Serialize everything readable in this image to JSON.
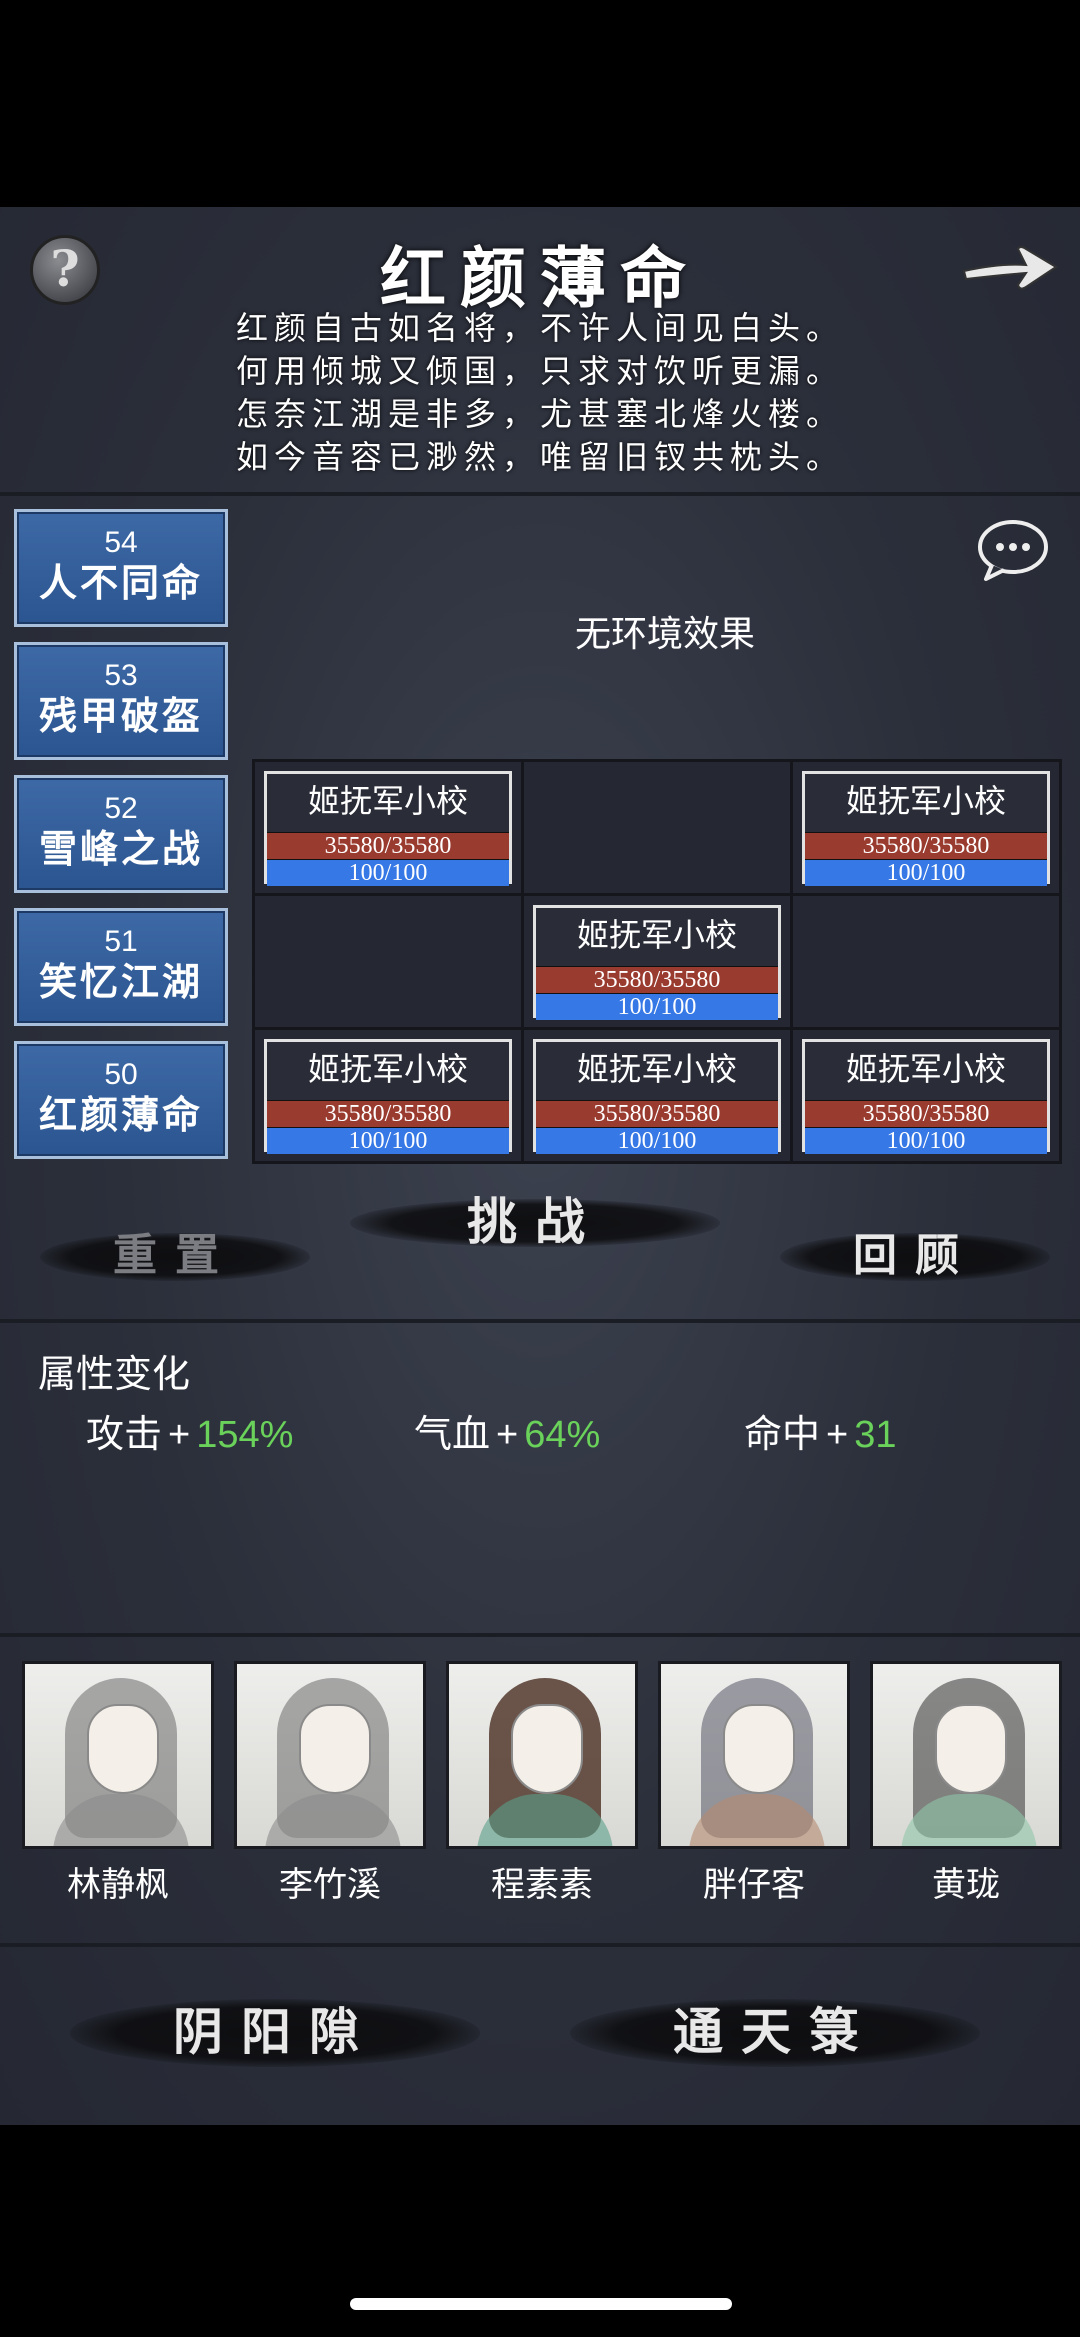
{
  "header": {
    "title": "红颜薄命",
    "poem": [
      "红颜自古如名将，不许人间见白头。",
      "何用倾城又倾国，只求对饮听更漏。",
      "怎奈江湖是非多，尤甚塞北烽火楼。",
      "如今音容已渺然，唯留旧钗共枕头。"
    ],
    "help_icon": "question-icon",
    "next_icon": "arrow-right-icon"
  },
  "levels": [
    {
      "num": "54",
      "name": "人不同命"
    },
    {
      "num": "53",
      "name": "残甲破盔"
    },
    {
      "num": "52",
      "name": "雪峰之战"
    },
    {
      "num": "51",
      "name": "笑忆江湖"
    },
    {
      "num": "50",
      "name": "红颜薄命"
    }
  ],
  "environment": "无环境效果",
  "formation": [
    {
      "name": "姬抚军小校",
      "hp": "35580/35580",
      "mp": "100/100"
    },
    null,
    {
      "name": "姬抚军小校",
      "hp": "35580/35580",
      "mp": "100/100"
    },
    null,
    {
      "name": "姬抚军小校",
      "hp": "35580/35580",
      "mp": "100/100"
    },
    null,
    {
      "name": "姬抚军小校",
      "hp": "35580/35580",
      "mp": "100/100"
    },
    {
      "name": "姬抚军小校",
      "hp": "35580/35580",
      "mp": "100/100"
    },
    {
      "name": "姬抚军小校",
      "hp": "35580/35580",
      "mp": "100/100"
    }
  ],
  "actions": {
    "reset": "重置",
    "challenge": "挑战",
    "review": "回顾"
  },
  "attributes": {
    "title": "属性变化",
    "items": [
      {
        "label": "攻击",
        "plus": "+",
        "value": "154%"
      },
      {
        "label": "气血",
        "plus": "+",
        "value": "64%"
      },
      {
        "label": "命中",
        "plus": "+",
        "value": "31"
      }
    ]
  },
  "heroes": [
    {
      "name": "林静枫"
    },
    {
      "name": "李竹溪"
    },
    {
      "name": "程素素"
    },
    {
      "name": "胖仔客"
    },
    {
      "name": "黄珑"
    }
  ],
  "bottom": {
    "yinyang": "阴阳隙",
    "tongtian": "通天箓"
  },
  "colors": {
    "level_bg": "#2b5590",
    "hp_bar": "#9a3b30",
    "mp_bar": "#3578e6",
    "positive": "#6ad25a"
  }
}
